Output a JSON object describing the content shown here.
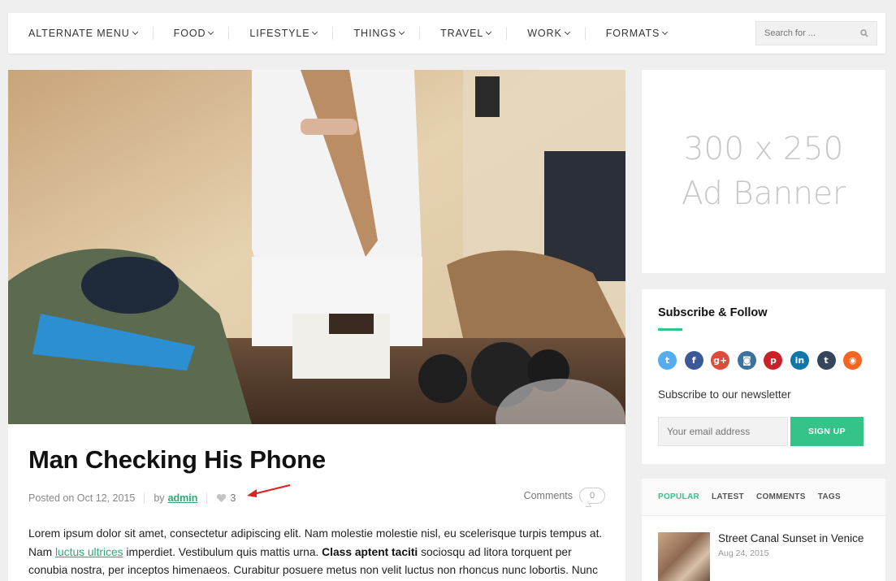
{
  "nav": {
    "items": [
      {
        "label": "ALTERNATE MENU"
      },
      {
        "label": "FOOD"
      },
      {
        "label": "LIFESTYLE"
      },
      {
        "label": "THINGS"
      },
      {
        "label": "TRAVEL"
      },
      {
        "label": "WORK"
      },
      {
        "label": "FORMATS"
      }
    ],
    "search_placeholder": "Search for ..."
  },
  "post": {
    "title": "Man Checking His Phone",
    "posted_prefix": "Posted on",
    "date": "Oct 12, 2015",
    "by_label": "by",
    "author": "admin",
    "likes": "3",
    "comments_label": "Comments",
    "comments_count": "0",
    "body_1": "Lorem ipsum dolor sit amet, consectetur adipiscing elit. Nam molestie molestie nisl, eu scelerisque turpis tempus at. Nam ",
    "body_link": "luctus ultrices",
    "body_2": " imperdiet. Vestibulum quis mattis urna. ",
    "body_bold": "Class aptent taciti",
    "body_3": " sociosqu ad litora torquent per conubia nostra, per inceptos himenaeos. Curabitur posuere metus non velit luctus non rhoncus nunc lobortis. Nunc"
  },
  "ad": {
    "line1": "300 x 250",
    "line2": "Ad Banner"
  },
  "subscribe": {
    "title": "Subscribe & Follow",
    "socials": [
      {
        "name": "twitter",
        "glyph": "t",
        "color": "#55acee"
      },
      {
        "name": "facebook",
        "glyph": "f",
        "color": "#3b5998"
      },
      {
        "name": "google-plus",
        "glyph": "g+",
        "color": "#dd4b39"
      },
      {
        "name": "instagram",
        "glyph": "◙",
        "color": "#3f729b"
      },
      {
        "name": "pinterest",
        "glyph": "p",
        "color": "#cb2027"
      },
      {
        "name": "linkedin",
        "glyph": "in",
        "color": "#0e76a8"
      },
      {
        "name": "tumblr",
        "glyph": "t",
        "color": "#35465c"
      },
      {
        "name": "rss",
        "glyph": "◉",
        "color": "#f26522"
      }
    ],
    "newsletter_label": "Subscribe to our newsletter",
    "email_placeholder": "Your email address",
    "signup_label": "SIGN UP"
  },
  "tabs": {
    "items": [
      "POPULAR",
      "LATEST",
      "COMMENTS",
      "TAGS"
    ],
    "popular": [
      {
        "title": "Street Canal Sunset in Venice",
        "date": "Aug 24, 2015"
      }
    ]
  },
  "colors": {
    "accent": "#35c38a",
    "link": "#2fa874"
  }
}
